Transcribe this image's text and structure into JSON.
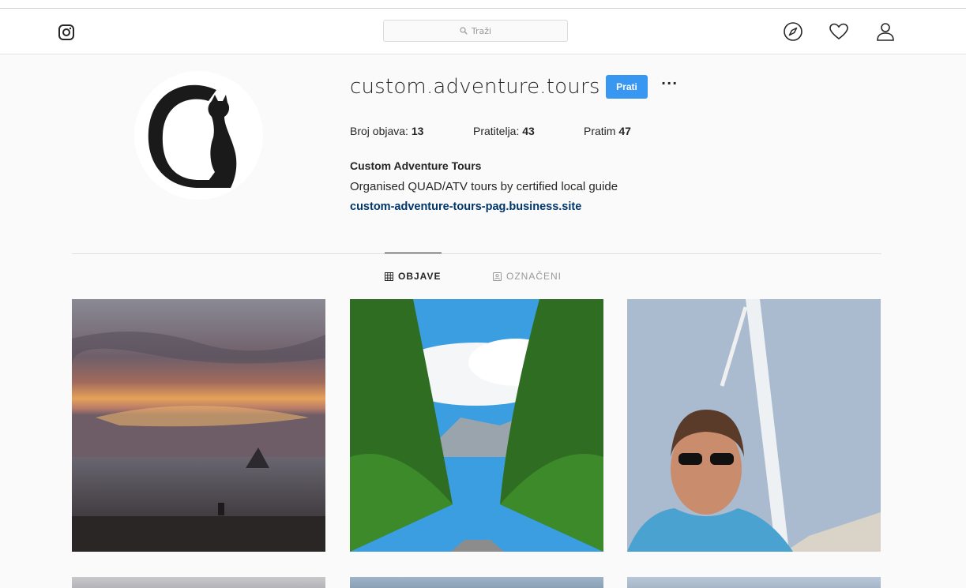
{
  "search": {
    "placeholder": "Traži"
  },
  "profile": {
    "username": "custom.adventure.tours",
    "follow_label": "Prati",
    "more_label": "···",
    "stats": [
      {
        "label": "Broj objava: ",
        "value": "13"
      },
      {
        "label": "Pratitelja: ",
        "value": "43"
      },
      {
        "label": "Pratim ",
        "value": "47"
      }
    ],
    "full_name": "Custom Adventure Tours",
    "bio": "Organised QUAD/ATV tours by certified local guide",
    "website": "custom-adventure-tours-pag.business.site"
  },
  "tabs": [
    {
      "label": "OBJAVE",
      "icon": "grid-icon",
      "active": true
    },
    {
      "label": "OZNAČENI",
      "icon": "tagged-icon",
      "active": false
    }
  ],
  "icons": {
    "logo": "instagram-icon",
    "explore": "compass-icon",
    "activity": "heart-icon",
    "profile": "person-icon"
  },
  "colors": {
    "accent": "#3897f0",
    "link": "#003569"
  }
}
